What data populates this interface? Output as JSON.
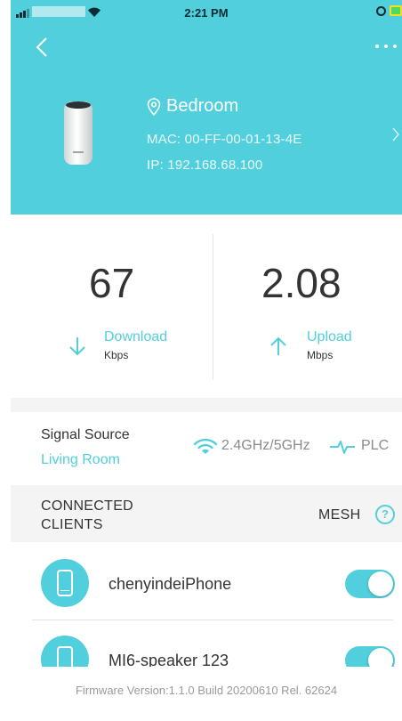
{
  "status_bar": {
    "time": "2:21 PM"
  },
  "device": {
    "location": "Bedroom",
    "mac": "MAC: 00-FF-00-01-13-4E",
    "ip": "IP: 192.168.68.100"
  },
  "speeds": {
    "download": {
      "value": "67",
      "label": "Download",
      "unit": "Kbps"
    },
    "upload": {
      "value": "2.08",
      "label": "Upload",
      "unit": "Mbps"
    }
  },
  "signal": {
    "title": "Signal Source",
    "source": "Living Room",
    "band": "2.4GHz/5GHz",
    "plc": "PLC"
  },
  "clients": {
    "title_line1": "CONNECTED",
    "title_line2": "CLIENTS",
    "mesh_label": "MESH",
    "help": "?",
    "items": [
      {
        "name": "chenyindeiPhone",
        "enabled": true
      },
      {
        "name": "MI6-speaker 123",
        "enabled": true
      }
    ]
  },
  "footer": {
    "firmware": "Firmware Version:1.1.0 Build 20200610 Rel. 62624"
  },
  "colors": {
    "accent": "#52cfdc",
    "text": "#333333",
    "muted": "#9a9a9a"
  },
  "icons": {
    "back": "chevron-left-icon",
    "more": "more-dots-icon",
    "location": "location-pin-icon",
    "download": "arrow-down-icon",
    "upload": "arrow-up-icon",
    "wifi": "wifi-icon",
    "plc": "plc-icon",
    "phone": "phone-icon"
  }
}
